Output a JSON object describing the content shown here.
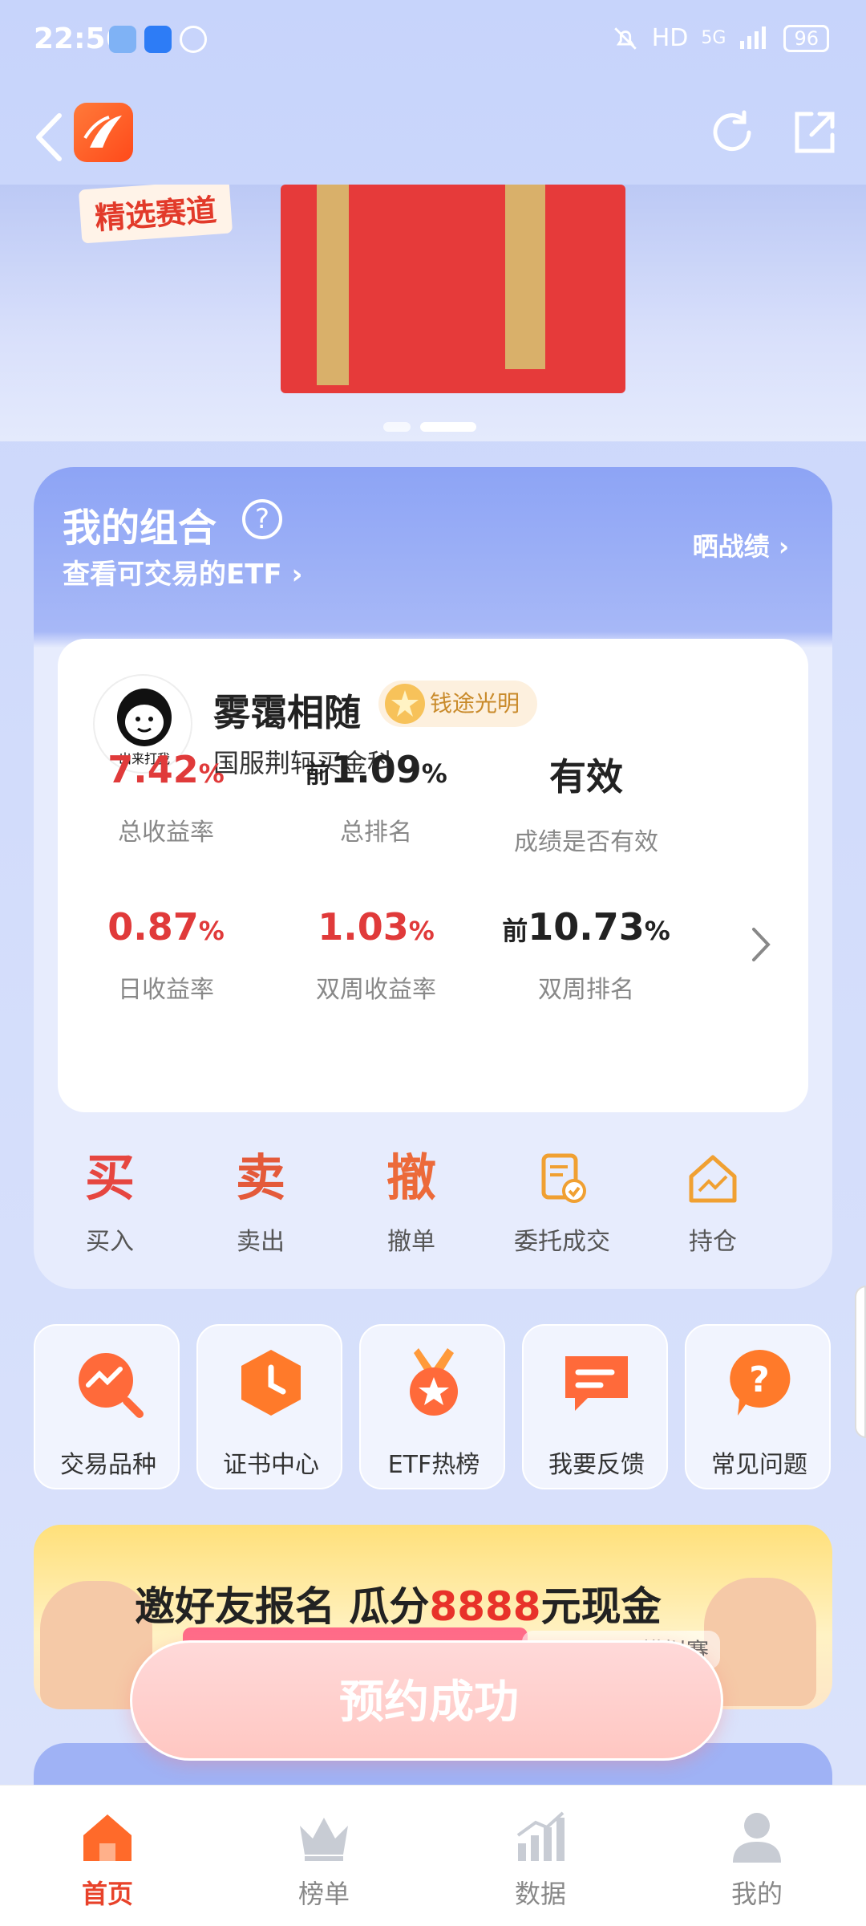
{
  "status_bar": {
    "time": "22:56",
    "network": "HD",
    "signal": "5G",
    "battery": "96"
  },
  "portfolio": {
    "title": "我的组合",
    "help_icon": "?",
    "subtitle": "查看可交易的ETF",
    "share_label": "晒战绩",
    "user": {
      "name": "雾霭相随",
      "badge": "钱途光明",
      "team": "国服荆轲买金科",
      "avatar_caption": "出来打我"
    },
    "stats": [
      {
        "prefix": "",
        "value": "7.42",
        "unit": "%",
        "label": "总收益率",
        "color": "red"
      },
      {
        "prefix": "前",
        "value": "1.09",
        "unit": "%",
        "label": "总排名",
        "color": "dark"
      },
      {
        "prefix": "",
        "value": "有效",
        "unit": "",
        "label": "成绩是否有效",
        "color": "dark"
      },
      {
        "prefix": "",
        "value": "0.87",
        "unit": "%",
        "label": "日收益率",
        "color": "red"
      },
      {
        "prefix": "",
        "value": "1.03",
        "unit": "%",
        "label": "双周收益率",
        "color": "red"
      },
      {
        "prefix": "前",
        "value": "10.73",
        "unit": "%",
        "label": "双周排名",
        "color": "dark"
      }
    ],
    "actions": [
      {
        "glyph": "买",
        "label": "买入"
      },
      {
        "glyph": "卖",
        "label": "卖出"
      },
      {
        "glyph": "撤",
        "label": "撤单"
      },
      {
        "glyph": "",
        "label": "委托成交",
        "icon": "order-document-icon"
      },
      {
        "glyph": "",
        "label": "持仓",
        "icon": "house-chart-icon"
      }
    ]
  },
  "banner": {
    "tag": "精选赛道"
  },
  "shortcuts": [
    {
      "label": "交易品种",
      "icon": "trend-magnifier-icon"
    },
    {
      "label": "证书中心",
      "icon": "clock-hexagon-icon"
    },
    {
      "label": "ETF热榜",
      "icon": "medal-star-icon"
    },
    {
      "label": "我要反馈",
      "icon": "chat-bubble-icon"
    },
    {
      "label": "常见问题",
      "icon": "question-bubble-icon"
    }
  ],
  "promo": {
    "title_prefix": "邀好友报名 瓜分",
    "title_highlight": "8888",
    "title_suffix": "元现金",
    "subtitle": "下一届ETF模拟赛"
  },
  "reserve_button": {
    "label": "预约成功"
  },
  "bottom_nav": [
    {
      "label": "首页",
      "icon": "home-icon",
      "active": true
    },
    {
      "label": "榜单",
      "icon": "crown-icon",
      "active": false
    },
    {
      "label": "数据",
      "icon": "bar-chart-icon",
      "active": false
    },
    {
      "label": "我的",
      "icon": "person-icon",
      "active": false
    }
  ],
  "colors": {
    "accent": "#e8422a",
    "rise": "#e03a3a",
    "primary_blue": "#8da4f5"
  }
}
